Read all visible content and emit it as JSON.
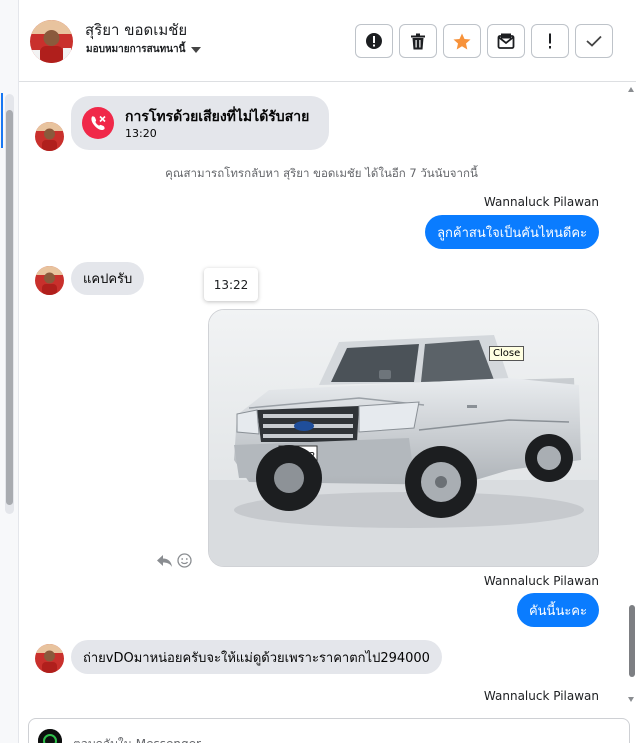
{
  "header": {
    "contact_name": "สุริยา ขอดเมชัย",
    "assign_label": "มอบหมายการสนทนานี้",
    "actions": [
      {
        "icon": "exclamation-circle-icon"
      },
      {
        "icon": "trash-icon"
      },
      {
        "icon": "star-icon",
        "color": "#f7923a"
      },
      {
        "icon": "spam-mail-icon"
      },
      {
        "icon": "exclamation-icon"
      },
      {
        "icon": "checkmark-icon"
      }
    ]
  },
  "messages": {
    "missed_call": {
      "title": "การโทรด้วยเสียงที่ไม่ได้รับสาย",
      "time": "13:20"
    },
    "callback_note": "คุณสามารถโทรกลับหา สุริยา ขอดเมชัย ได้ในอีก 7 วันนับจากนี้",
    "sender_1": "Wannaluck Pilawan",
    "out_1": "ลูกค้าสนใจเป็นคันไหนดีคะ",
    "in_1": "แคปครับ",
    "tooltip_time": "13:22",
    "close_tip": "Close",
    "plate": "ผค 552",
    "sender_2": "Wannaluck Pilawan",
    "out_2": "คันนี้นะคะ",
    "in_2": "ถ่ายvDOมาหน่อยครับจะให้แม่ดูด้วยเพราะราคาตกไป294000",
    "sender_3": "Wannaluck Pilawan"
  },
  "composer": {
    "placeholder": "ตอบกลับใน Messenger"
  },
  "colors": {
    "accent": "#0a7cff",
    "missed_call": "#f02849",
    "incoming_bubble": "#e4e6eb"
  }
}
